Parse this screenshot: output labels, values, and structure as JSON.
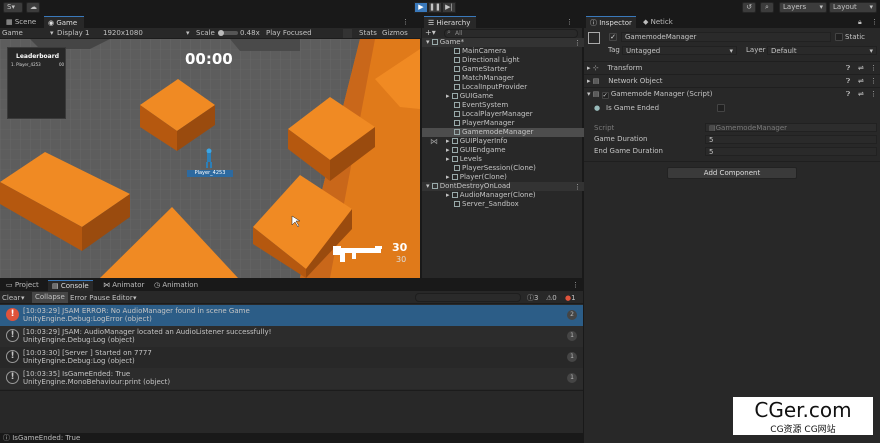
{
  "toolbar": {
    "account": "S",
    "layers": "Layers",
    "layout": "Layout"
  },
  "scene_tabs": {
    "scene": "Scene",
    "game": "Game"
  },
  "game_toolbar": {
    "display_mode": "Game",
    "display": "Display 1",
    "resolution": "1920x1080",
    "scale_label": "Scale",
    "scale_value": "0.48x",
    "play_focused": "Play Focused",
    "stats": "Stats",
    "gizmos": "Gizmos"
  },
  "game_view": {
    "timer": "00:00",
    "leaderboard_title": "Leaderboard",
    "leaderboard_entry": "1. Player_4253",
    "leaderboard_score": "00",
    "player_tag": "Player_4253",
    "ammo_current": "30",
    "ammo_reserve": "30"
  },
  "hierarchy": {
    "tab": "Hierarchy",
    "search_placeholder": "All",
    "items": [
      {
        "label": "Game*"
      },
      {
        "label": "MainCamera"
      },
      {
        "label": "Directional Light"
      },
      {
        "label": "GameStarter"
      },
      {
        "label": "MatchManager"
      },
      {
        "label": "LocalInputProvider"
      },
      {
        "label": "GUIGame"
      },
      {
        "label": "EventSystem"
      },
      {
        "label": "LocalPlayerManager"
      },
      {
        "label": "PlayerManager"
      },
      {
        "label": "GamemodeManager"
      },
      {
        "label": "GUIPlayerInfo"
      },
      {
        "label": "GUIEndgame"
      },
      {
        "label": "Levels"
      },
      {
        "label": "PlayerSession(Clone)"
      },
      {
        "label": "Player(Clone)"
      },
      {
        "label": "DontDestroyOnLoad"
      },
      {
        "label": "AudioManager(Clone)"
      },
      {
        "label": "Server_Sandbox"
      }
    ]
  },
  "inspector": {
    "tab_inspector": "Inspector",
    "tab_netick": "Netick",
    "object_name": "GamemodeManager",
    "static_label": "Static",
    "tag_label": "Tag",
    "tag_value": "Untagged",
    "layer_label": "Layer",
    "layer_value": "Default",
    "components": [
      "Transform",
      "Network Object",
      "Gamemode Manager (Script)"
    ],
    "is_game_ended_label": "Is Game Ended",
    "script_label": "Script",
    "script_value": "GamemodeManager",
    "game_duration_label": "Game Duration",
    "game_duration_value": "5",
    "end_game_duration_label": "End Game Duration",
    "end_game_duration_value": "5",
    "add_component": "Add Component"
  },
  "console": {
    "tabs": [
      "Project",
      "Console",
      "Animator",
      "Animation"
    ],
    "clear": "Clear",
    "collapse": "Collapse",
    "error_pause": "Error Pause",
    "editor": "Editor",
    "info_count": "3",
    "warn_count": "0",
    "error_count": "1",
    "entries": [
      {
        "line1": "[10:03:29] JSAM ERROR: No AudioManager found in scene Game",
        "line2": "UnityEngine.Debug:LogError (object)",
        "count": "2",
        "type": "error"
      },
      {
        "line1": "[10:03:29] JSAM: AudioManager located an AudioListener successfully!",
        "line2": "UnityEngine.Debug:Log (object)",
        "count": "1",
        "type": "info"
      },
      {
        "line1": "[10:03:30] [Server ] Started on 7777",
        "line2": "UnityEngine.Debug:Log (object)",
        "count": "1",
        "type": "info"
      },
      {
        "line1": "[10:03:35] IsGameEnded: True",
        "line2": "UnityEngine.MonoBehaviour:print (object)",
        "count": "1",
        "type": "info"
      }
    ],
    "status_line": "IsGameEnded: True"
  },
  "watermark": {
    "line1": "CGer.com",
    "line2": "CG资源 CG网站"
  }
}
